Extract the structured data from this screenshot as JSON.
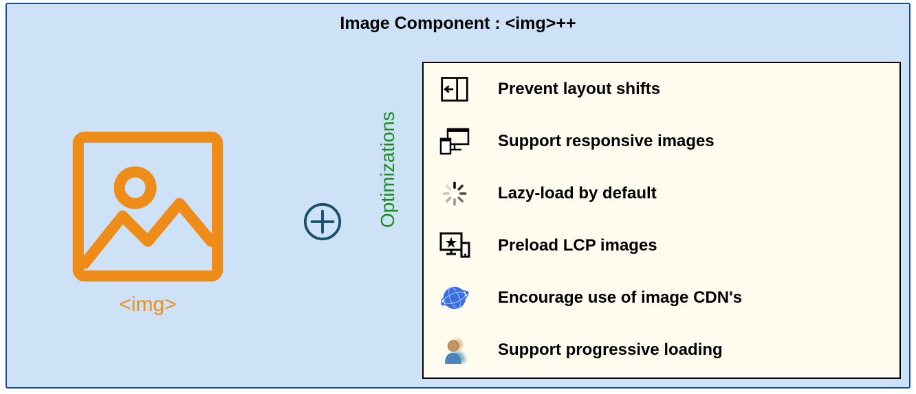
{
  "title": "Image Component : <img>++",
  "img_label": "<img>",
  "optimizations_label": "Optimizations",
  "optimizations": {
    "items": [
      {
        "label": "Prevent layout shifts"
      },
      {
        "label": "Support responsive images"
      },
      {
        "label": "Lazy-load by default"
      },
      {
        "label": "Preload LCP images"
      },
      {
        "label": "Encourage use of image CDN's"
      },
      {
        "label": "Support progressive loading"
      }
    ]
  }
}
